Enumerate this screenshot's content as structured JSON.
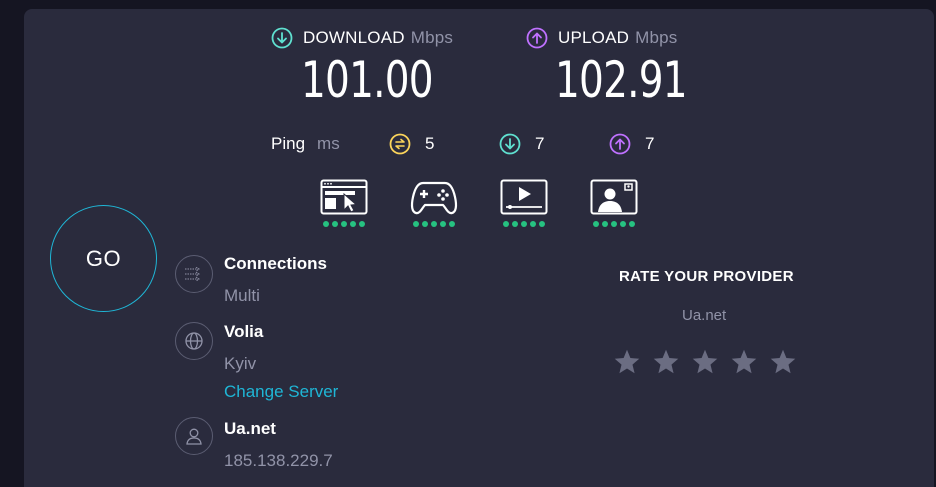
{
  "download": {
    "label": "DOWNLOAD",
    "unit": "Mbps",
    "value": "101.00",
    "icon": "arrow-down-circle-icon",
    "color": "#5fe0d0"
  },
  "upload": {
    "label": "UPLOAD",
    "unit": "Mbps",
    "value": "102.91",
    "icon": "arrow-up-circle-icon",
    "color": "#bf71ff"
  },
  "ping": {
    "label": "Ping",
    "unit": "ms",
    "idle": "5",
    "download": "7",
    "upload": "7",
    "idle_color": "#fbd45b"
  },
  "usecases": [
    {
      "icon": "web-browsing-icon",
      "rating": 5
    },
    {
      "icon": "gamepad-icon",
      "rating": 5
    },
    {
      "icon": "video-streaming-icon",
      "rating": 5
    },
    {
      "icon": "video-call-icon",
      "rating": 5
    }
  ],
  "go_button": {
    "label": "GO"
  },
  "connections": {
    "title": "Connections",
    "value": "Multi",
    "icon": "connections-icon"
  },
  "server": {
    "name": "Volia",
    "location": "Kyiv",
    "change_label": "Change Server",
    "icon": "globe-icon"
  },
  "provider": {
    "name": "Ua.net",
    "ip": "185.138.229.7",
    "icon": "user-icon"
  },
  "rate": {
    "title": "RATE YOUR PROVIDER",
    "isp": "Ua.net",
    "stars": 5,
    "star_color": "#6b6d82"
  },
  "colors": {
    "background": "#151522",
    "panel": "#2a2b3d",
    "accent": "#1fb6d6",
    "good": "#26c281"
  }
}
